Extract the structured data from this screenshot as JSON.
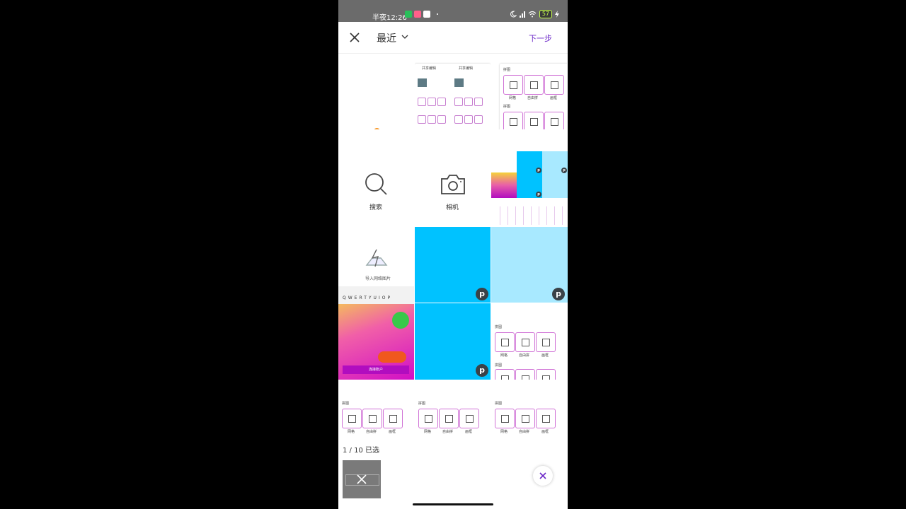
{
  "status_bar": {
    "time": "半夜12:26",
    "battery": "57",
    "icons": [
      "app-green-icon",
      "app-pink-icon",
      "app-panda-icon",
      "moon-icon",
      "signal-icon",
      "wifi-icon",
      "battery-icon",
      "charging-icon"
    ]
  },
  "header": {
    "close_icon": "close-icon",
    "album_title": "最近",
    "dropdown_icon": "chevron-down-icon",
    "next_label": "下一步"
  },
  "grid": {
    "search_label": "搜索",
    "camera_label": "相机",
    "import_label": "导入网络图片",
    "keyboard_row": [
      "Q",
      "W",
      "E",
      "R",
      "T",
      "Y",
      "U",
      "I",
      "O",
      "P"
    ],
    "thumbnail_header_label": "共享编辑",
    "section_label": "拼图",
    "layout_labels": [
      "网格",
      "自由拼",
      "画框"
    ],
    "promo_button_label": "连接账户"
  },
  "tray": {
    "selected_count": "1 / 10 已选",
    "remove_icon": "close-icon",
    "clear_icon": "close-icon"
  },
  "colors": {
    "accent": "#6d2ac8",
    "cyan": "#00c2ff",
    "light_cyan": "#a8e9ff",
    "magenta": "#b10dbf",
    "orange_dot": "#f7931e"
  }
}
